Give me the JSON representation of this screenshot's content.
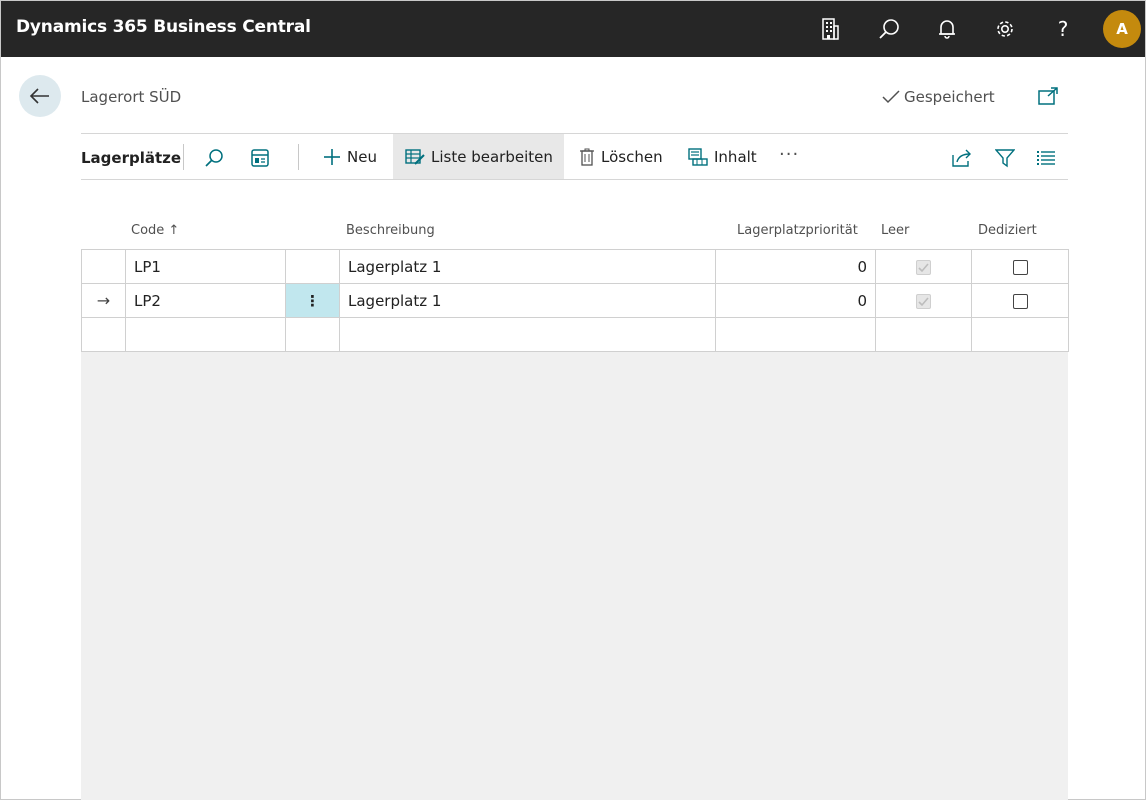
{
  "app": {
    "title": "Dynamics 365 Business Central",
    "avatar_initial": "A",
    "icons": [
      "company-icon",
      "search-icon",
      "bell-icon",
      "gear-icon",
      "help-icon"
    ]
  },
  "page": {
    "title": "Lagerort SÜD",
    "saved_label": "Gespeichert"
  },
  "actionbar": {
    "title": "Lagerplätze",
    "new_label": "Neu",
    "edit_list_label": "Liste bearbeiten",
    "delete_label": "Löschen",
    "contents_label": "Inhalt",
    "more_label": "···"
  },
  "table": {
    "columns": {
      "code": "Code ↑",
      "description": "Beschreibung",
      "priority": "Lagerplatzpriorität",
      "empty": "Leer",
      "dedicated": "Dediziert"
    },
    "rows": [
      {
        "code": "LP1",
        "description": "Lagerplatz 1",
        "priority": "0",
        "empty": true,
        "dedicated": false,
        "selected": false
      },
      {
        "code": "LP2",
        "description": "Lagerplatz 1",
        "priority": "0",
        "empty": true,
        "dedicated": false,
        "selected": true
      }
    ],
    "current_row_marker": "→",
    "row_menu_glyph": "⋮"
  },
  "colors": {
    "appbar": "#262626",
    "avatar": "#c48a0e",
    "accent": "#00707e",
    "selected_cell": "#c1e7ee"
  }
}
